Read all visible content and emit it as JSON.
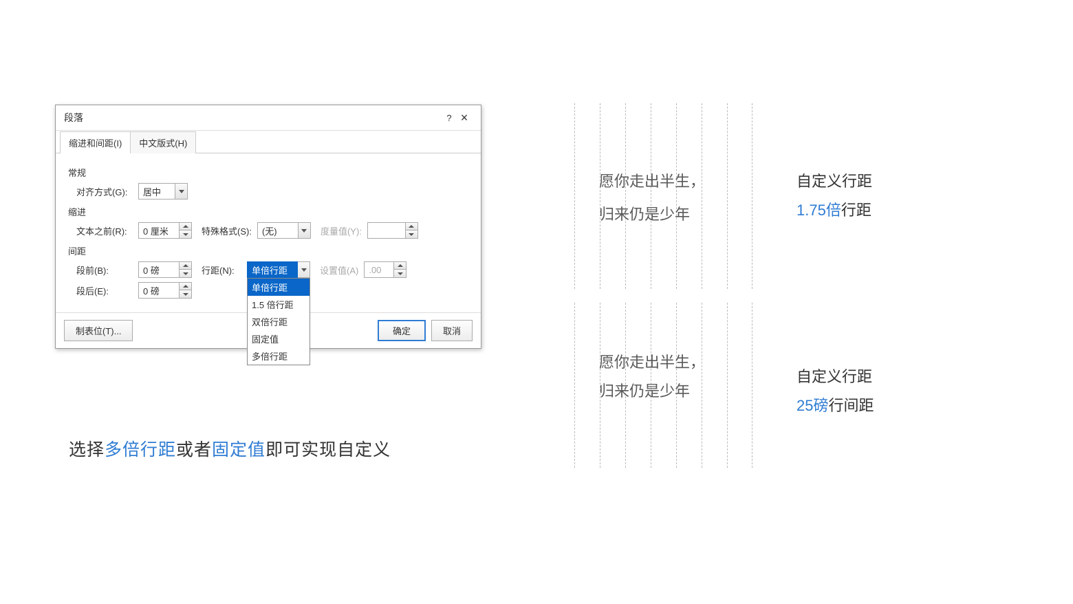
{
  "dialog": {
    "title": "段落",
    "help": "?",
    "close": "×",
    "tabs": {
      "indent": "缩进和间距(I)",
      "chinese": "中文版式(H)"
    },
    "sections": {
      "general": "常规",
      "indent": "缩进",
      "spacing": "间距"
    },
    "labels": {
      "alignment": "对齐方式(G):",
      "textBefore": "文本之前(R):",
      "specialFormat": "特殊格式(S):",
      "measureValue": "度量值(Y):",
      "before": "段前(B):",
      "after": "段后(E):",
      "lineSpacing": "行距(N):",
      "setValue": "设置值(A)"
    },
    "values": {
      "alignment": "居中",
      "textBefore": "0 厘米",
      "specialFormat": "(无)",
      "before": "0 磅",
      "after": "0 磅",
      "lineSpacingSelected": "单倍行距",
      "setValue": ".00"
    },
    "dropdownOptions": [
      "单倍行距",
      "1.5 倍行距",
      "双倍行距",
      "固定值",
      "多倍行距"
    ],
    "footer": {
      "tabs": "制表位(T)...",
      "ok": "确定",
      "cancel": "取消"
    }
  },
  "caption": {
    "part1": "选择",
    "hl1": "多倍行距",
    "part2": "或者",
    "hl2": "固定值",
    "part3": "即可实现自定义"
  },
  "examples": {
    "text1": "愿你走出半生，",
    "text2": "归来仍是少年",
    "label1a": "自定义行距",
    "label1b_hl": "1.75倍",
    "label1b_rest": "行距",
    "label2a": "自定义行距",
    "label2b_hl": "25磅",
    "label2b_rest": "行间距"
  }
}
